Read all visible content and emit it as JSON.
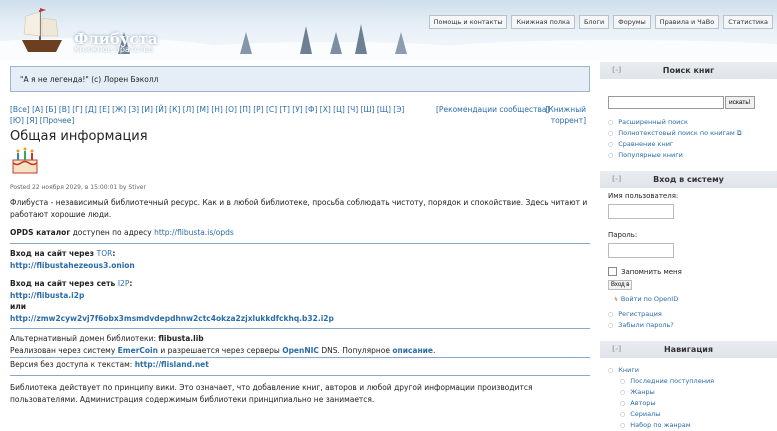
{
  "header": {
    "site_name": "Флибуста",
    "slogan": "Книжное братство",
    "nav": [
      "Помощь и контакты",
      "Книжная полка",
      "Блоги",
      "Форумы",
      "Правила и ЧаВо",
      "Статистика"
    ]
  },
  "quote": "\"А я не легенда!\" (с) Лорен Бэколл",
  "alphabet": {
    "line1": "[Все] [A] [Б] [В] [Г] [Д] [Е] [Ж] [З] [И] [Й] [К] [Л] [М] [Н] [О] [П] [Р] [С] [Т] [У] [Ф] [Х] [Ц] [Ч] [Ш] [Щ] [Э]",
    "line2": "[Ю] [Я] [Прочее]",
    "recommendations": "[Рекомендации сообщества]",
    "torrent_1": "[Книжный",
    "torrent_2": "торрент]"
  },
  "article": {
    "title": "Общая информация",
    "posted": "Posted 22 ноября 2029, в 15:00:01 by Stiver",
    "intro": "Флибуста - независимый библиотечный ресурс. Как и в любой библиотеке, просьба соблюдать чистоту, порядок и спокойствие. Здесь читают и работают хорошие люди.",
    "opds_label": "OPDS каталог",
    "opds_text": " доступен по адресу ",
    "opds_url": "http://flibusta.is/opds",
    "tor_label": "Вход на сайт через ",
    "tor_link": "TOR",
    "tor_colon": ":",
    "tor_url": "http://flibustahezeous3.onion",
    "i2p_label": "Вход на сайт через сеть ",
    "i2p_link": "I2P",
    "i2p_colon": ":",
    "i2p_url": "http://flibusta.i2p",
    "or": "или",
    "i2p_url2": "http://zmw2cyw2vj7f6obx3msmdvdepdhnw2ctc4okza2zjxlukkdfckhq.b32.i2p",
    "alt_domain_label": "Альтернативный домен библиотеки: ",
    "alt_domain": "flibusta.lib",
    "emercoin_text_1": "Реализован через систему ",
    "emercoin": "EmerCoin",
    "emercoin_text_2": " и разрешается через серверы ",
    "opennic": "OpenNIC",
    "emercoin_text_3": " DNS. Популярное ",
    "opis": "описание",
    "emercoin_text_4": ".",
    "text_version_label": "Версия без доступа к текстам: ",
    "text_version_url": "http://flisland.net",
    "wiki_text": "Библиотека действует по принципу вики. Это означает, что добавление книг, авторов и любой другой информации производится пользователями. Администрация содержимым библиотеки принципиально не занимается."
  },
  "sidebar": {
    "search_title": "Поиск книг",
    "search_button": "искать!",
    "search_links": [
      "Расширенный поиск",
      "Полнотекстовый поиск по книгам",
      "Сравнение книг",
      "Популярные книги"
    ],
    "login_title": "Вход в систему",
    "username_label": "Имя пользователя:",
    "password_label": "Пароль:",
    "remember_label": "Запомнить меня",
    "login_button": "Вход в с",
    "openid_label": "Войти по OpenID",
    "account_links": [
      "Регистрация",
      "Забыли пароль?"
    ],
    "nav_title": "Навигация",
    "nav_root": "Книги",
    "nav_items": [
      "Последние поступления",
      "Жанры",
      "Авторы",
      "Сериалы",
      "Набор по жанрам"
    ]
  }
}
